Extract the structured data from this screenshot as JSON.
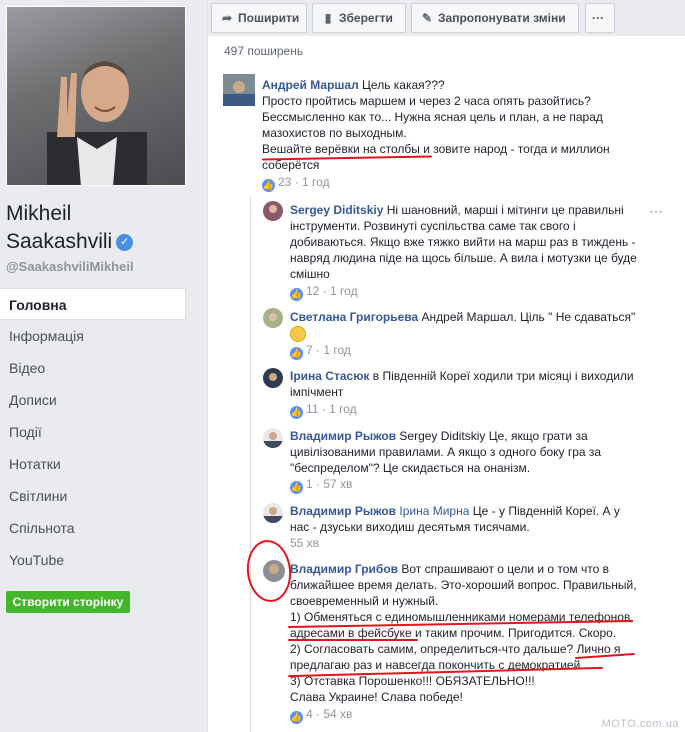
{
  "profile": {
    "name_line1": "Mikheil",
    "name_line2": "Saakashvili",
    "handle": "@SaakashviliMikheil"
  },
  "nav": [
    "Головна",
    "Інформація",
    "Відео",
    "Дописи",
    "Події",
    "Нотатки",
    "Світлини",
    "Спільнота",
    "YouTube"
  ],
  "create_page_label": "Створити сторінку",
  "actions": {
    "share": "Поширити",
    "save": "Зберегти",
    "suggest": "Запропонувати зміни",
    "more": "···"
  },
  "shares_count": "497 поширень",
  "comments": [
    {
      "author": "Андрей Маршал",
      "text": "Цель какая???",
      "lines": [
        "Просто пройтись маршем и через 2 часа опять разойтись?",
        "Бессмысленно как то... Нужна ясная цель и план, а не парад",
        "мазохистов по выходным.",
        "Вешайте верёвки на столбы и зовите народ - тогда и миллион",
        "соберётся"
      ],
      "likes": "23",
      "time": "1 год"
    },
    {
      "author": "Sergey Diditskiy",
      "text": "Ні шановний, марші і мітинги це правильні",
      "lines": [
        "інструменти. Розвинуті суспільства саме так свого і",
        "добиваються. Якщо вже тяжко вийти на марш раз в тиждень -",
        "навряд людина піде на щось більше. А вила і мотузки це буде",
        "смішно"
      ],
      "likes": "12",
      "time": "1 год"
    },
    {
      "author": "Светлана Григорьева",
      "text": "Андрей Маршал. Ціль \" Не сдаваться\"",
      "likes": "7",
      "time": "1 год"
    },
    {
      "author": "Ірина Стасюк",
      "text": "в Південній Кореї ходили три місяці і виходили",
      "lines": [
        "імпічмент"
      ],
      "likes": "11",
      "time": "1 год"
    },
    {
      "author": "Владимир Рыжов",
      "text": "Sergey Diditskiy Це, якщо грати за",
      "lines": [
        "цивілізованими правилами. А якщо з одного боку гра за",
        "\"беспределом\"? Це скидається на онанізм."
      ],
      "likes": "1",
      "time": "57 хв"
    },
    {
      "author": "Владимир Рыжов",
      "mention": "Ірина Мирна",
      "text": "Це - у Південній Кореї. А у",
      "lines": [
        "нас - дзуськи виходиш десятьмя тисячами."
      ],
      "time": "55 хв"
    },
    {
      "author": "Владимир Грибов",
      "text": "Вот спрашивают о цели и о том что в",
      "lines": [
        "ближайшее время делать. Это-хороший вопрос. Правильный,",
        "своевременный и нужный.",
        "1) Обменяться с единомышленниками номерами телефонов,",
        "адресами в фейсбуке и таким прочим. Пригодится. Скоро.",
        "2) Согласовать самим, определиться-что дальше? Лично я",
        "предлагаю раз и навсегда покончить с демократией.",
        "3) Отставка Порошенко!!! ОБЯЗАТЕЛЬНО!!!",
        "Слава Украине! Слава победе!"
      ],
      "likes": "4",
      "time": "54 хв"
    }
  ],
  "watermark": "MOTO.com.ua"
}
